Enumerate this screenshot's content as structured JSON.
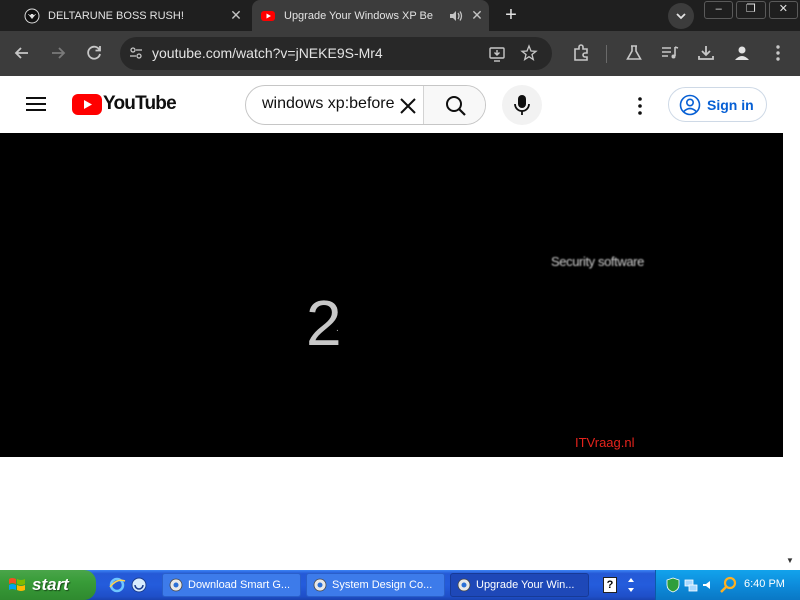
{
  "browser": {
    "tabs": [
      {
        "title": "DELTARUNE BOSS RUSH!",
        "active": false
      },
      {
        "title": "Upgrade Your Windows XP Be",
        "active": true
      }
    ],
    "new_tab_label": "+",
    "window_controls": {
      "minimize": "–",
      "restore": "❐",
      "close": "✕"
    },
    "url": "youtube.com/watch?v=jNEKE9S-Mr4"
  },
  "youtube": {
    "logo_text": "YouTube",
    "search_value": "windows xp:before",
    "signin_label": "Sign in"
  },
  "video": {
    "countdown": "2",
    "dot": ".",
    "caption": "Security software",
    "watermark": "ITVraag.nl"
  },
  "taskbar": {
    "start_label": "start",
    "buttons": [
      {
        "label": "Download Smart G...",
        "active": false
      },
      {
        "label": "System Design Co...",
        "active": false
      },
      {
        "label": "Upgrade Your Win...",
        "active": true
      }
    ],
    "help_label": "?",
    "clock": "6:40 PM"
  },
  "colors": {
    "youtube_red": "#ff0000",
    "signin_blue": "#065fd4",
    "xp_start_green": "#389c38",
    "xp_taskbar_blue": "#245cdc",
    "watermark_red": "#e4231c"
  }
}
